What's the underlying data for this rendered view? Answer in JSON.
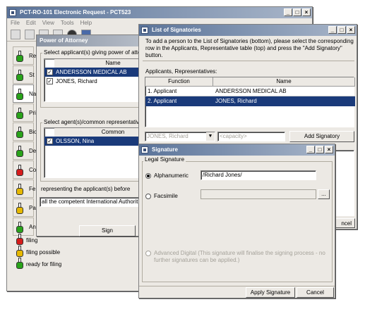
{
  "main_window": {
    "title": "PCT-RO-101 Electronic Request - PCT523",
    "menu": [
      "File",
      "Edit",
      "View",
      "Tools",
      "Help"
    ],
    "nav_items": [
      {
        "label": "Re",
        "color": "#29a31a"
      },
      {
        "label": "St",
        "color": "#29a31a"
      },
      {
        "label": "Na",
        "color": "#29a31a"
      },
      {
        "label": "Pri",
        "color": "#29a31a"
      },
      {
        "label": "Bio",
        "color": "#29a31a"
      },
      {
        "label": "De",
        "color": "#29a31a"
      },
      {
        "label": "Co",
        "color": "#d61c1c"
      },
      {
        "label": "Fe",
        "color": "#e6b800"
      },
      {
        "label": "Pa",
        "color": "#e6b800"
      },
      {
        "label": "An",
        "color": "#29a31a"
      }
    ],
    "legend": [
      {
        "label": "filing",
        "color": "#d61c1c"
      },
      {
        "label": "filing possible",
        "color": "#e6b800"
      },
      {
        "label": "ready for filing",
        "color": "#29a31a"
      }
    ]
  },
  "poa_window": {
    "title": "Power of Attorney",
    "applicant_group_label": "Select applicant(s) giving power of attorney",
    "applicant_header": "Name",
    "applicants": [
      {
        "name": "ANDERSSON MEDICAL AB",
        "checked": true,
        "selected": true
      },
      {
        "name": "JONES, Richard",
        "checked": true,
        "selected": false
      }
    ],
    "agent_group_label": "Select agent(s)/common representative to w",
    "agent_header": "Common",
    "agents": [
      {
        "name": "OLSSON, Nina",
        "checked": true,
        "selected": true
      }
    ],
    "representing_label": "representing the applicant(s) before",
    "authorities_value": "all the competent International Authorities",
    "sign_button": "Sign"
  },
  "signatories_window": {
    "title": "List of Signatories",
    "instructions": "To add a person to the List of Signatories (bottom), please select the corresponding row in the Applicants, Representative table (top) and press the \"Add Signatory\" button.",
    "table_label": "Applicants, Representatives:",
    "columns": [
      "Function",
      "Name"
    ],
    "rows": [
      {
        "function": "1. Applicant",
        "name": "ANDERSSON MEDICAL AB",
        "selected": false
      },
      {
        "function": "2. Applicant",
        "name": "JONES,  Richard",
        "selected": true
      }
    ],
    "person_select_value": "JONES,  Richard",
    "capacity_placeholder": "<capacity>",
    "add_button": "Add Signatory",
    "cancel_partial": "ncel"
  },
  "signature_window": {
    "title": "Signature",
    "group_label": "Legal Signature",
    "option_alphanumeric": "Alphanumeric",
    "alphanumeric_value": "/Richard Jones/",
    "option_facsimile": "Facsimile",
    "browse_label": "...",
    "option_advanced": "Advanced Digital (This signature will finalise the signing process - no further signatures can be applied.)",
    "apply_button": "Apply Signature",
    "cancel_button": "Cancel"
  }
}
